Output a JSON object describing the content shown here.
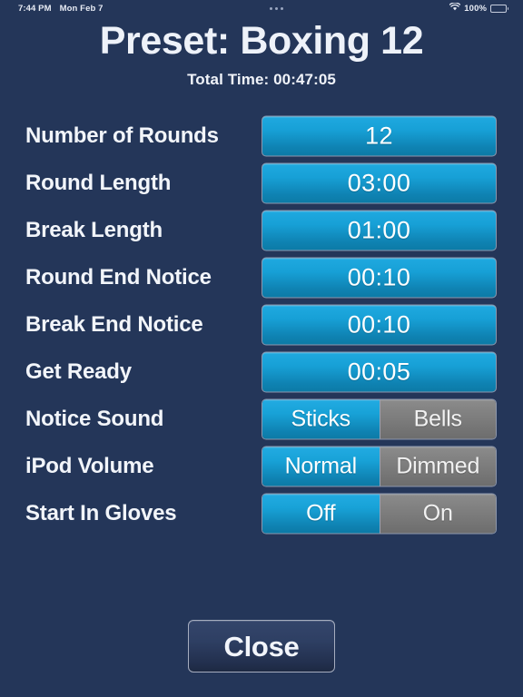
{
  "status_bar": {
    "time": "7:44 PM",
    "date": "Mon Feb 7",
    "multitask_dots": "•••",
    "wifi_icon": "wifi-icon",
    "battery_percent": "100%",
    "battery_icon": "battery-full-icon"
  },
  "header": {
    "title": "Preset: Boxing 12",
    "total_time": "Total Time: 00:47:05"
  },
  "settings": {
    "rows": [
      {
        "label": "Number of Rounds",
        "type": "value",
        "value": "12"
      },
      {
        "label": "Round Length",
        "type": "value",
        "value": "03:00"
      },
      {
        "label": "Break Length",
        "type": "value",
        "value": "01:00"
      },
      {
        "label": "Round End Notice",
        "type": "value",
        "value": "00:10"
      },
      {
        "label": "Break End Notice",
        "type": "value",
        "value": "00:10"
      },
      {
        "label": "Get Ready",
        "type": "value",
        "value": "00:05"
      },
      {
        "label": "Notice Sound",
        "type": "segmented",
        "options": [
          "Sticks",
          "Bells"
        ],
        "selected": "Sticks"
      },
      {
        "label": "iPod Volume",
        "type": "segmented",
        "options": [
          "Normal",
          "Dimmed"
        ],
        "selected": "Normal"
      },
      {
        "label": "Start In Gloves",
        "type": "segmented",
        "options": [
          "Off",
          "On"
        ],
        "selected": "Off"
      }
    ]
  },
  "footer": {
    "close_label": "Close"
  },
  "colors": {
    "background": "#243659",
    "accent_blue_top": "#22abe2",
    "accent_blue_bottom": "#0c7aa6",
    "segment_inactive": "#7f7f7f",
    "text": "#f2f5fa",
    "button_border": "#8d97ad"
  }
}
